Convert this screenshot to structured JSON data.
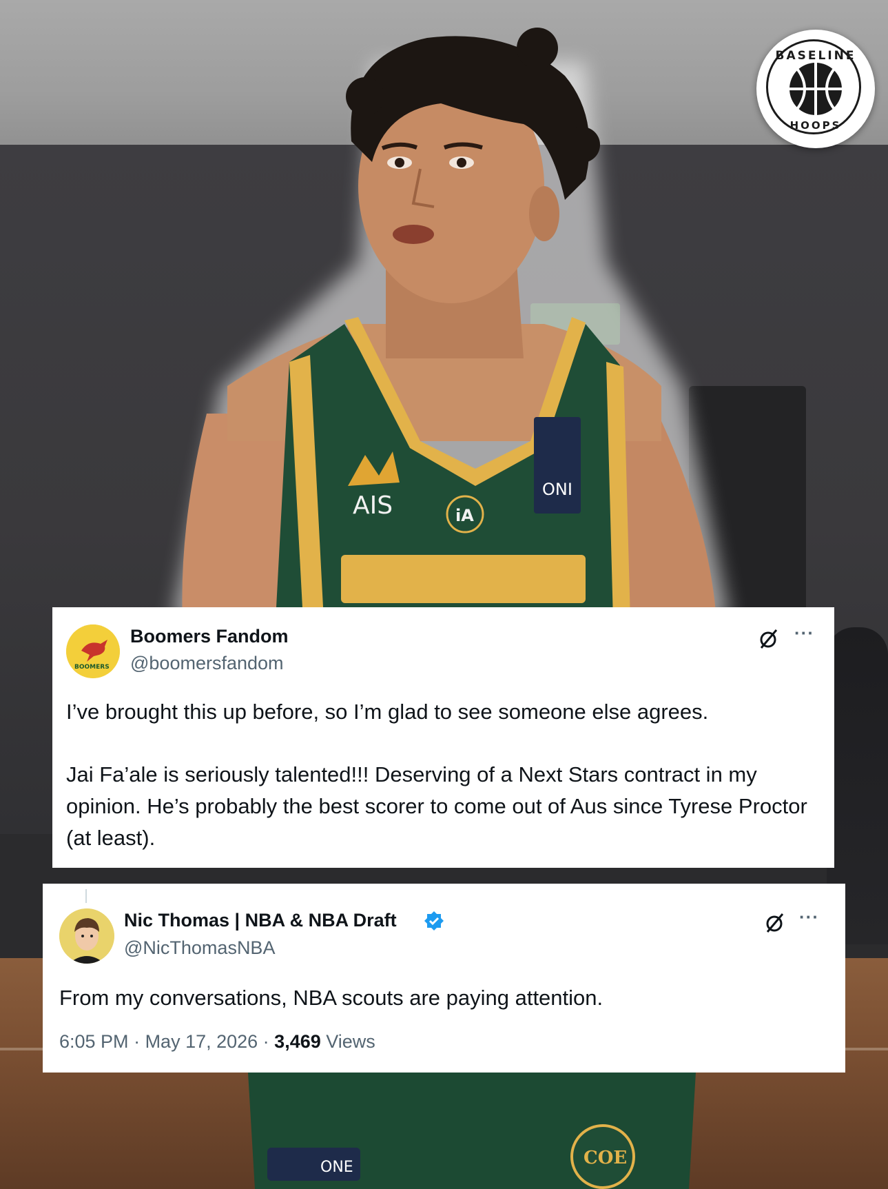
{
  "brand": {
    "logo_top": "BASELINE",
    "logo_bottom": "HOOPS"
  },
  "jersey": {
    "sponsor": "AIS",
    "badge": "ONI",
    "front": "COE",
    "shorts": "ONE"
  },
  "tweets": [
    {
      "display_name": "Boomers Fandom",
      "handle": "@boomersfandom",
      "avatar_text": "BOOMERS",
      "paragraph_1": "I’ve brought this up before, so I’m glad to see someone else agrees.",
      "paragraph_2": "Jai Fa’ale is seriously talented!!! Deserving of a Next Stars contract in my opinion. He’s probably the best scorer to come out of Aus since Tyrese Proctor (at least).",
      "more_label": "···"
    },
    {
      "display_name": "Nic Thomas | NBA & NBA Draft",
      "handle": "@NicThomasNBA",
      "verified": true,
      "paragraph_1": "From my conversations, NBA scouts are paying attention.",
      "time": "6:05 PM",
      "separator": " · ",
      "date": "May 17, 2026",
      "views_count": "3,469",
      "views_label": " Views",
      "more_label": "···"
    }
  ],
  "colors": {
    "card_bg": "#ffffff",
    "text_primary": "#0f1419",
    "text_secondary": "#536471",
    "verified_blue": "#1d9bf0",
    "jersey_green": "#1f4d36",
    "jersey_gold": "#e2b24a"
  }
}
